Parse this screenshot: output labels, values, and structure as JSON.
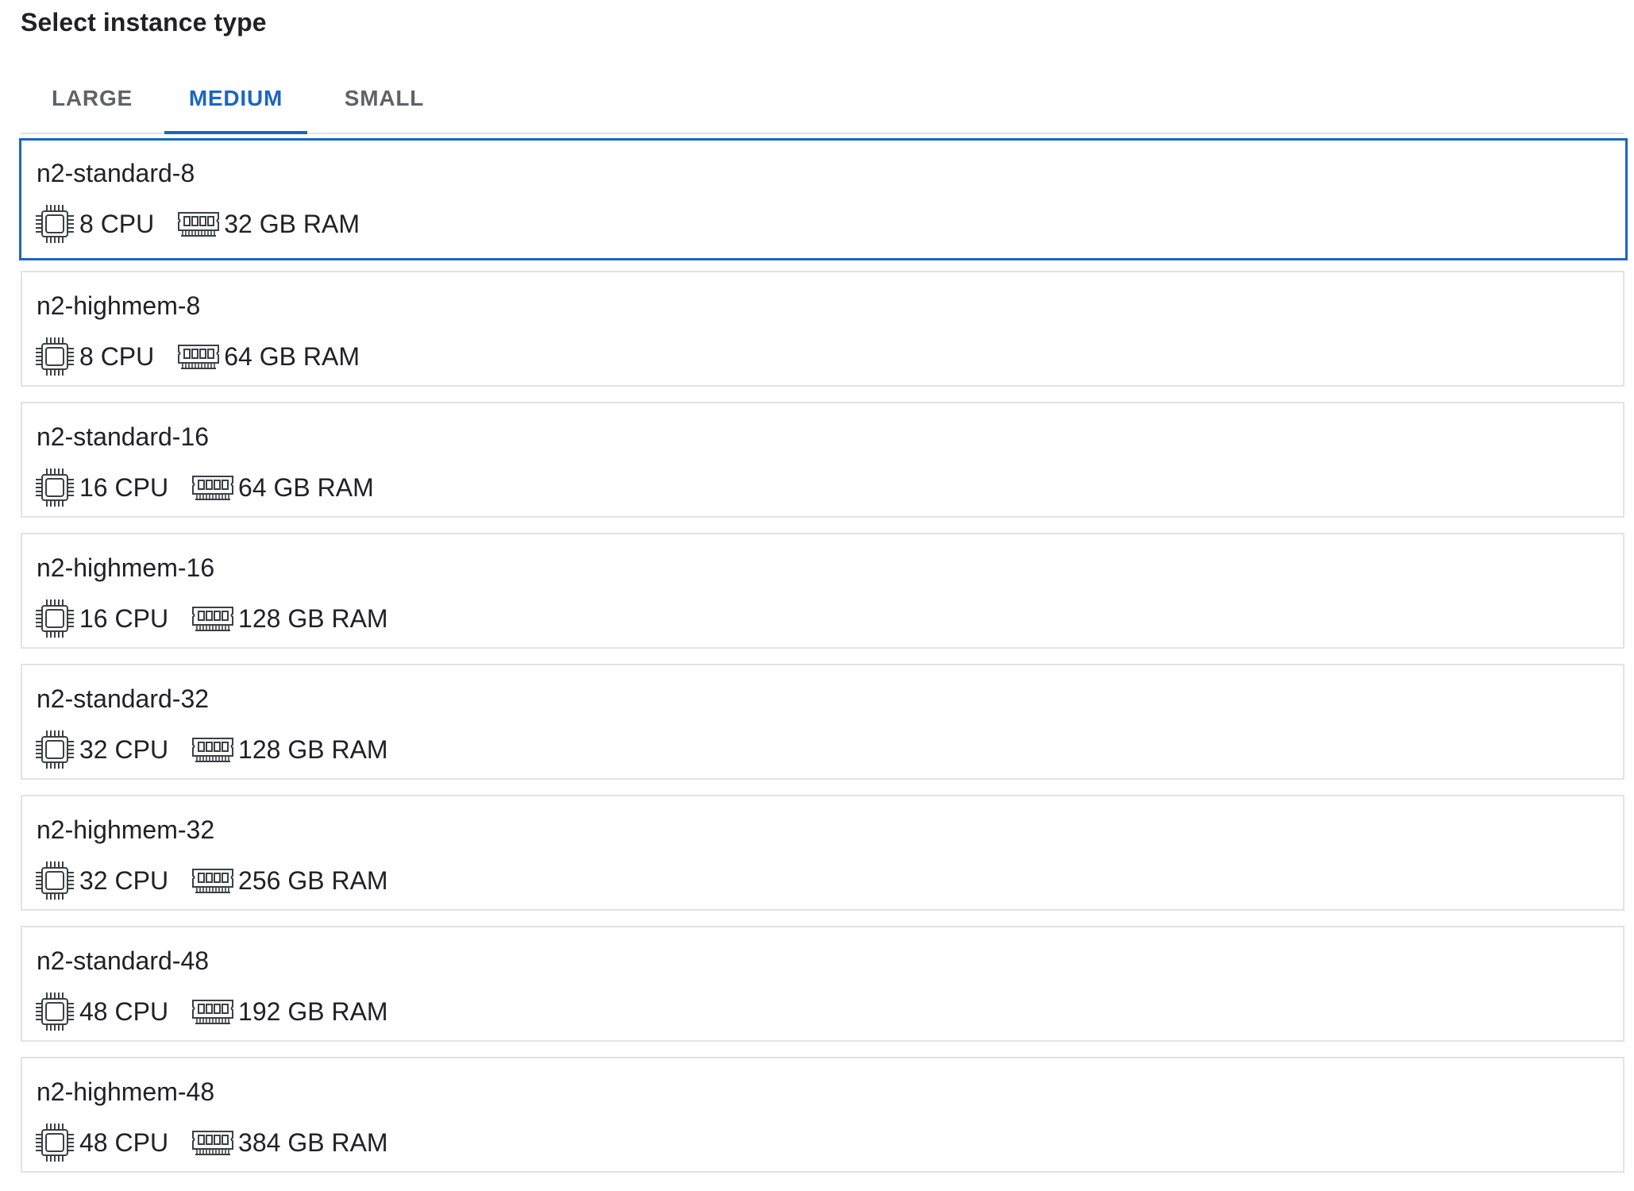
{
  "heading": "Select instance type",
  "tabs": [
    {
      "label": "LARGE",
      "active": false
    },
    {
      "label": "MEDIUM",
      "active": true
    },
    {
      "label": "SMALL",
      "active": false
    }
  ],
  "colors": {
    "accent": "#1a66c2",
    "border": "#e3e3e3",
    "text": "#202124",
    "tab_inactive": "#5f6368"
  },
  "instances": [
    {
      "name": "n2-standard-8",
      "cpu": "8 CPU",
      "ram": "32 GB RAM",
      "selected": true
    },
    {
      "name": "n2-highmem-8",
      "cpu": "8 CPU",
      "ram": "64 GB RAM",
      "selected": false
    },
    {
      "name": "n2-standard-16",
      "cpu": "16 CPU",
      "ram": "64 GB RAM",
      "selected": false
    },
    {
      "name": "n2-highmem-16",
      "cpu": "16 CPU",
      "ram": "128 GB RAM",
      "selected": false
    },
    {
      "name": "n2-standard-32",
      "cpu": "32 CPU",
      "ram": "128 GB RAM",
      "selected": false
    },
    {
      "name": "n2-highmem-32",
      "cpu": "32 CPU",
      "ram": "256 GB RAM",
      "selected": false
    },
    {
      "name": "n2-standard-48",
      "cpu": "48 CPU",
      "ram": "192 GB RAM",
      "selected": false
    },
    {
      "name": "n2-highmem-48",
      "cpu": "48 CPU",
      "ram": "384 GB RAM",
      "selected": false
    }
  ],
  "icons": {
    "cpu": "cpu-chip-icon",
    "ram": "memory-module-icon"
  }
}
